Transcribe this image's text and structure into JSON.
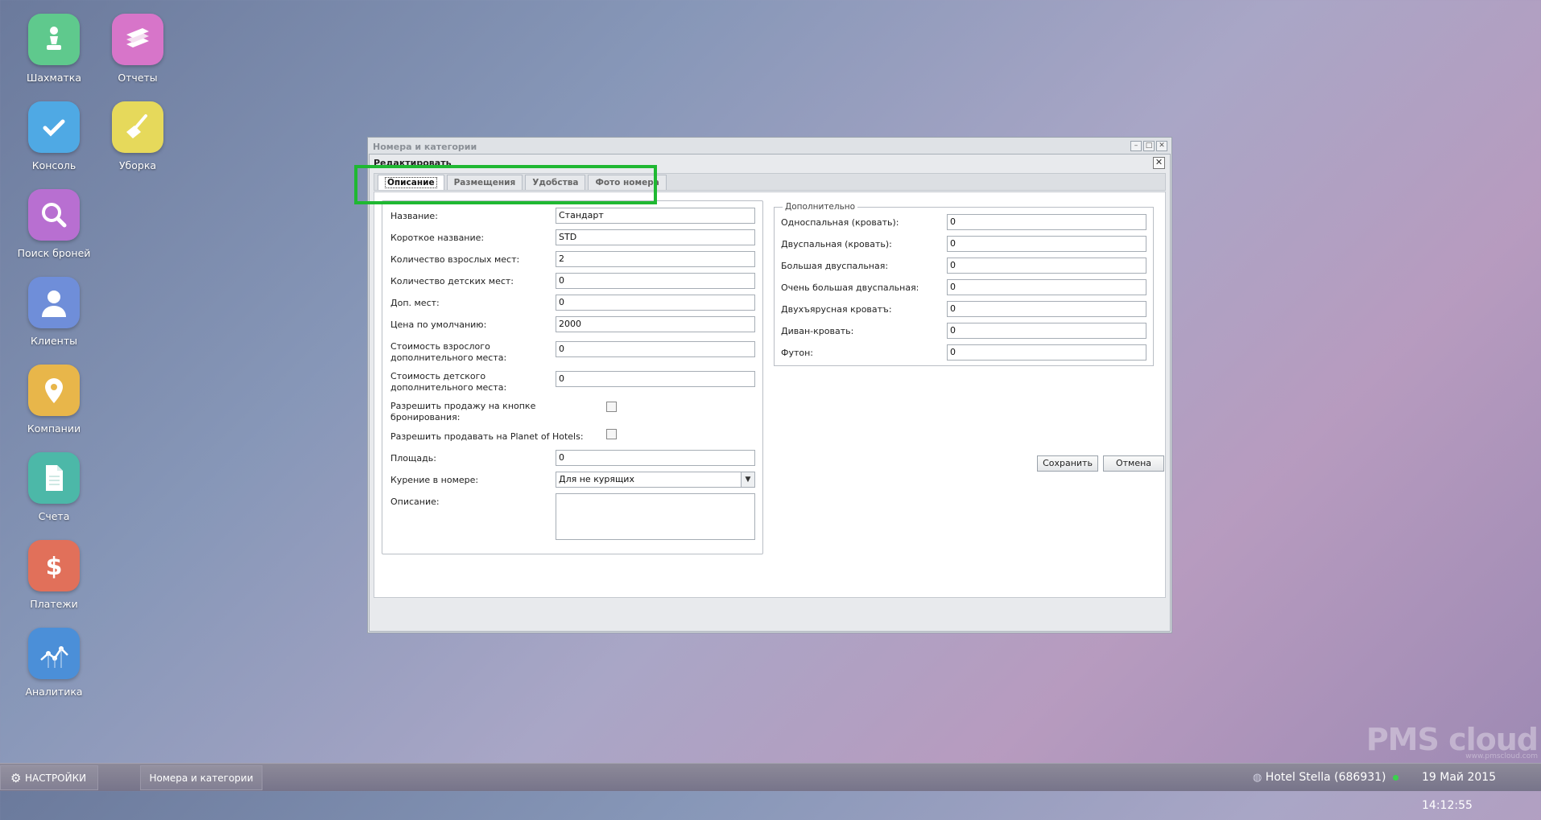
{
  "desktop": {
    "icons": [
      {
        "label": "Шахматка",
        "icon": "chess-pawn-icon",
        "color": "#5fc98d"
      },
      {
        "label": "Отчеты",
        "icon": "books-icon",
        "color": "#d775c9"
      },
      {
        "label": "Консоль",
        "icon": "check-icon",
        "color": "#4fa9e4"
      },
      {
        "label": "Уборка",
        "icon": "broom-icon",
        "color": "#e6d95b"
      },
      {
        "label": "Поиск броней",
        "icon": "magnifier-icon",
        "color": "#b86fd1"
      },
      {
        "label": "Клиенты",
        "icon": "person-icon",
        "color": "#6f8ed9"
      },
      {
        "label": "Компании",
        "icon": "location-pin-icon",
        "color": "#e8b64a"
      },
      {
        "label": "Счета",
        "icon": "document-icon",
        "color": "#4cb8a8"
      },
      {
        "label": "Платежи",
        "icon": "dollar-icon",
        "color": "#e1705a"
      },
      {
        "label": "Аналитика",
        "icon": "analytics-chart-icon",
        "color": "#4b8fd8"
      }
    ]
  },
  "outer_window": {
    "title": "Номера и категории"
  },
  "editor": {
    "title": "Редактировать",
    "tabs": [
      "Описание",
      "Размещения",
      "Удобства",
      "Фото номера"
    ],
    "active_tab": "Описание",
    "fields": {
      "name": {
        "label": "Название:",
        "value": "Стандарт"
      },
      "short_name": {
        "label": "Короткое название:",
        "value": "STD"
      },
      "adult_places": {
        "label": "Количество взрослых мест:",
        "value": "2"
      },
      "child_places": {
        "label": "Количество детских мест:",
        "value": "0"
      },
      "extra_places": {
        "label": "Доп. мест:",
        "value": "0"
      },
      "default_price": {
        "label": "Цена по умолчанию:",
        "value": "2000"
      },
      "adult_extra_cost": {
        "label": "Стоимость взрослого дополнительного места:",
        "value": "0"
      },
      "child_extra_cost": {
        "label": "Стоимость детского дополнительного места:",
        "value": "0"
      },
      "allow_booking_button": {
        "label": "Разрешить продажу на кнопке бронирования:",
        "checked": false
      },
      "allow_planet": {
        "label": "Разрешить продавать на Planet of Hotels:",
        "checked": false
      },
      "area": {
        "label": "Площадь:",
        "value": "0"
      },
      "smoking": {
        "label": "Курение в номере:",
        "value": "Для не курящих"
      },
      "description": {
        "label": "Описание:",
        "value": ""
      }
    },
    "additional": {
      "legend": "Дополнительно",
      "beds": [
        {
          "label": "Односпальная (кровать):",
          "value": "0"
        },
        {
          "label": "Двуспальная (кровать):",
          "value": "0"
        },
        {
          "label": "Большая двуспальная:",
          "value": "0"
        },
        {
          "label": "Очень большая двуспальная:",
          "value": "0"
        },
        {
          "label": "Двухъярусная кроватъ:",
          "value": "0"
        },
        {
          "label": "Диван-кровать:",
          "value": "0"
        },
        {
          "label": "Футон:",
          "value": "0"
        }
      ]
    },
    "buttons": {
      "save": "Сохранить",
      "cancel": "Отмена"
    }
  },
  "watermark": {
    "brand": "PMS cloud",
    "url": "www.pmscloud.com"
  },
  "taskbar": {
    "settings": "НАСТРОЙКИ",
    "window_item": "Номера и категории",
    "hotel": "Hotel Stella (686931)",
    "datetime": "19 Май 2015 14:12:55"
  }
}
